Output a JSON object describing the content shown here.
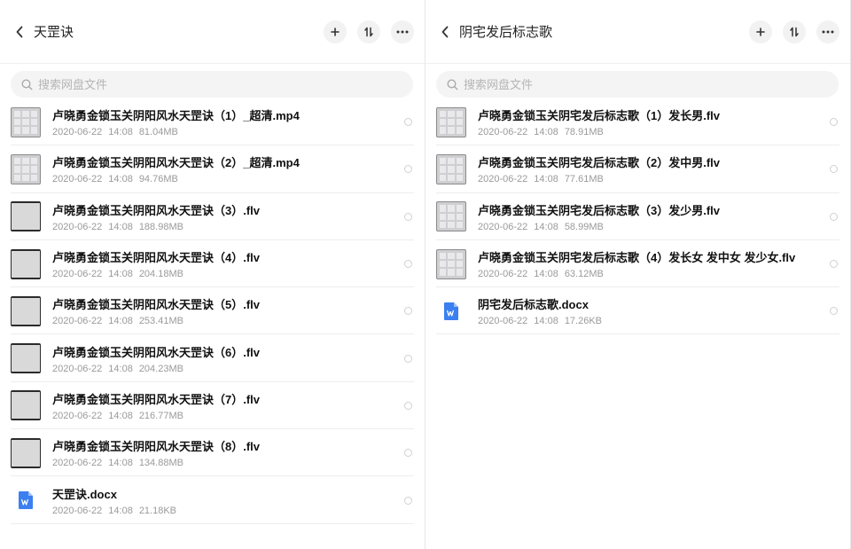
{
  "left": {
    "title": "天罡诀",
    "search_placeholder": "搜索网盘文件",
    "files": [
      {
        "name": "卢晓勇金锁玉关阴阳风水天罡诀（1）_超清.mp4",
        "date": "2020-06-22",
        "time": "14:08",
        "size": "81.04MB",
        "thumb": "photo"
      },
      {
        "name": "卢晓勇金锁玉关阴阳风水天罡诀（2）_超清.mp4",
        "date": "2020-06-22",
        "time": "14:08",
        "size": "94.76MB",
        "thumb": "photo"
      },
      {
        "name": "卢晓勇金锁玉关阴阳风水天罡诀（3）.flv",
        "date": "2020-06-22",
        "time": "14:08",
        "size": "188.98MB",
        "thumb": "grey"
      },
      {
        "name": "卢晓勇金锁玉关阴阳风水天罡诀（4）.flv",
        "date": "2020-06-22",
        "time": "14:08",
        "size": "204.18MB",
        "thumb": "grey"
      },
      {
        "name": "卢晓勇金锁玉关阴阳风水天罡诀（5）.flv",
        "date": "2020-06-22",
        "time": "14:08",
        "size": "253.41MB",
        "thumb": "grey"
      },
      {
        "name": "卢晓勇金锁玉关阴阳风水天罡诀（6）.flv",
        "date": "2020-06-22",
        "time": "14:08",
        "size": "204.23MB",
        "thumb": "grey"
      },
      {
        "name": "卢晓勇金锁玉关阴阳风水天罡诀（7）.flv",
        "date": "2020-06-22",
        "time": "14:08",
        "size": "216.77MB",
        "thumb": "grey"
      },
      {
        "name": "卢晓勇金锁玉关阴阳风水天罡诀（8）.flv",
        "date": "2020-06-22",
        "time": "14:08",
        "size": "134.88MB",
        "thumb": "grey"
      },
      {
        "name": "天罡诀.docx",
        "date": "2020-06-22",
        "time": "14:08",
        "size": "21.18KB",
        "thumb": "doc"
      }
    ]
  },
  "right": {
    "title": "阴宅发后标志歌",
    "search_placeholder": "搜索网盘文件",
    "files": [
      {
        "name": "卢晓勇金锁玉关阴宅发后标志歌（1）发长男.flv",
        "date": "2020-06-22",
        "time": "14:08",
        "size": "78.91MB",
        "thumb": "photo"
      },
      {
        "name": "卢晓勇金锁玉关阴宅发后标志歌（2）发中男.flv",
        "date": "2020-06-22",
        "time": "14:08",
        "size": "77.61MB",
        "thumb": "photo"
      },
      {
        "name": "卢晓勇金锁玉关阴宅发后标志歌（3）发少男.flv",
        "date": "2020-06-22",
        "time": "14:08",
        "size": "58.99MB",
        "thumb": "photo"
      },
      {
        "name": "卢晓勇金锁玉关阴宅发后标志歌（4）发长女 发中女 发少女.flv",
        "date": "2020-06-22",
        "time": "14:08",
        "size": "63.12MB",
        "thumb": "photo"
      },
      {
        "name": "阴宅发后标志歌.docx",
        "date": "2020-06-22",
        "time": "14:08",
        "size": "17.26KB",
        "thumb": "doc"
      }
    ]
  },
  "icons": {
    "back": "chevron-left-icon",
    "add": "plus-icon",
    "sort": "sort-icon",
    "more": "more-icon",
    "search": "search-icon",
    "doc": "word-doc-icon"
  },
  "colors": {
    "doc_blue": "#3b7ff0"
  }
}
